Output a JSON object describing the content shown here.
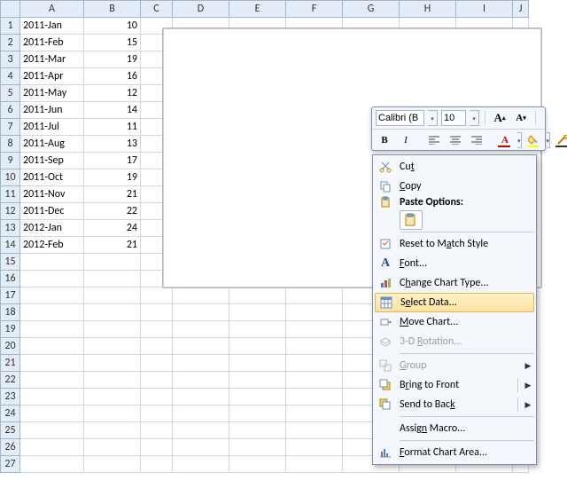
{
  "columns": [
    "A",
    "B",
    "C",
    "D",
    "E",
    "F",
    "G",
    "H",
    "I",
    "J"
  ],
  "rows": [
    {
      "n": 1,
      "a": "2011-Jan",
      "b": "10"
    },
    {
      "n": 2,
      "a": "2011-Feb",
      "b": "15"
    },
    {
      "n": 3,
      "a": "2011-Mar",
      "b": "19"
    },
    {
      "n": 4,
      "a": "2011-Apr",
      "b": "16"
    },
    {
      "n": 5,
      "a": "2011-May",
      "b": "12"
    },
    {
      "n": 6,
      "a": "2011-Jun",
      "b": "14"
    },
    {
      "n": 7,
      "a": "2011-Jul",
      "b": "11"
    },
    {
      "n": 8,
      "a": "2011-Aug",
      "b": "13"
    },
    {
      "n": 9,
      "a": "2011-Sep",
      "b": "17"
    },
    {
      "n": 10,
      "a": "2011-Oct",
      "b": "19"
    },
    {
      "n": 11,
      "a": "2011-Nov",
      "b": "21"
    },
    {
      "n": 12,
      "a": "2011-Dec",
      "b": "22"
    },
    {
      "n": 13,
      "a": "2012-Jan",
      "b": "24"
    },
    {
      "n": 14,
      "a": "2012-Feb",
      "b": "21"
    },
    {
      "n": 15
    },
    {
      "n": 16
    },
    {
      "n": 17
    },
    {
      "n": 18
    },
    {
      "n": 19
    },
    {
      "n": 20
    },
    {
      "n": 21
    },
    {
      "n": 22
    },
    {
      "n": 23
    },
    {
      "n": 24
    },
    {
      "n": 25
    },
    {
      "n": 26
    },
    {
      "n": 27
    }
  ],
  "mini": {
    "font_name": "Calibri (B",
    "font_size": "10",
    "bold": "B",
    "italic": "I"
  },
  "ctx": {
    "cut_pre": "Cu",
    "cut_u": "t",
    "copy_u": "C",
    "copy_post": "opy",
    "paste_label": "Paste Options:",
    "reset_pre": "Reset to M",
    "reset_u": "a",
    "reset_post": "tch Style",
    "font_u": "F",
    "font_post": "ont...",
    "cct_pre": "C",
    "cct_u": "h",
    "cct_post": "ange Chart Type...",
    "sel_pre": "S",
    "sel_u": "e",
    "sel_post": "lect Data...",
    "move_u": "M",
    "move_post": "ove Chart...",
    "rot_pre": "3-D ",
    "rot_u": "R",
    "rot_post": "otation...",
    "group_u": "G",
    "group_post": "roup",
    "btf_pre": "B",
    "btf_u": "r",
    "btf_post": "ing to Front",
    "stb_pre": "Send to Bac",
    "stb_u": "k",
    "macro_pre": "Assig",
    "macro_u": "n",
    "macro_post": " Macro...",
    "fca_u": "F",
    "fca_post": "ormat Chart Area..."
  }
}
